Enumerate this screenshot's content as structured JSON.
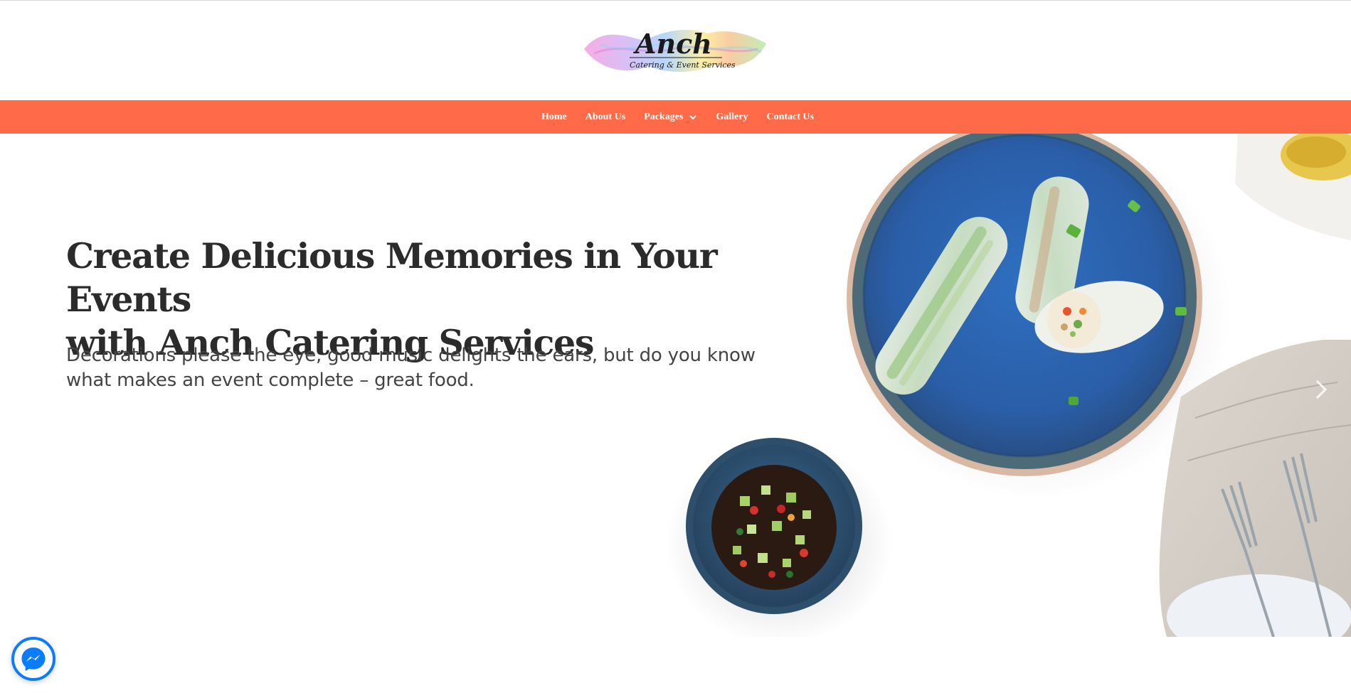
{
  "brand": {
    "name": "Anch",
    "tagline": "Catering & Event Services",
    "accent_color": "#ff6a48",
    "messenger_color": "#0a7cff"
  },
  "nav": {
    "items": [
      {
        "label": "Home"
      },
      {
        "label": "About Us"
      },
      {
        "label": "Packages",
        "has_dropdown": true,
        "icon": "chevron-down-icon"
      },
      {
        "label": "Gallery"
      },
      {
        "label": "Contact Us"
      }
    ]
  },
  "hero": {
    "title_line1": "Create Delicious Memories in Your Events",
    "title_line2": "with Anch Catering Services",
    "text": "Decorations please the eye, good music delights the ears, but do you know what makes an event complete – great food.",
    "image": "plate-of-spring-rolls-with-dipping-sauce-and-forks",
    "next_icon": "chevron-right-icon"
  },
  "chat_widget": {
    "icon": "messenger-icon"
  }
}
